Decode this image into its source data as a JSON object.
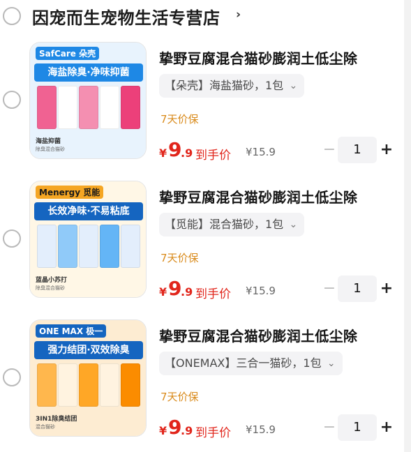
{
  "store": {
    "name": "因宠而生宠物生活专营店",
    "chevron": "›"
  },
  "items": [
    {
      "title": "挚野豆腐混合猫砂膨润土低尘除",
      "sku": "【朵壳】海盐猫砂，1包",
      "guarantee": "7天价保",
      "price_symbol": "¥",
      "price_int": "9",
      "price_dec": ".9",
      "price_label": "到手价",
      "original_price": "¥15.9",
      "quantity": "1",
      "thumb": {
        "logo": "SafCare 朵壳",
        "slogan": "海盐除臭·净味抑菌",
        "caption": "海盐抑菌",
        "caption_sub": "除臭混合猫砂",
        "accent": "#1e88e5",
        "slogan_bg": "#1e88e5",
        "bag_colors": [
          "#f06292",
          "#ffffff",
          "#f48fb1",
          "#ffffff",
          "#ec407a"
        ],
        "bg": "#e8f3fd"
      }
    },
    {
      "title": "挚野豆腐混合猫砂膨润土低尘除",
      "sku": "【觅能】混合猫砂，1包",
      "guarantee": "7天价保",
      "price_symbol": "¥",
      "price_int": "9",
      "price_dec": ".9",
      "price_label": "到手价",
      "original_price": "¥15.9",
      "quantity": "1",
      "thumb": {
        "logo": "Menergy 觅能",
        "slogan": "长效净味·不易粘底",
        "caption": "蓝晶小苏打",
        "caption_sub": "除臭混合猫砂",
        "accent": "#f5a623",
        "slogan_bg": "#1565c0",
        "bag_colors": [
          "#e3eefc",
          "#90caf9",
          "#e3eefc",
          "#64b5f6",
          "#e3eefc"
        ],
        "bg": "#fff7e6"
      }
    },
    {
      "title": "挚野豆腐混合猫砂膨润土低尘除",
      "sku": "【ONEMAX】三合一猫砂，1包",
      "guarantee": "7天价保",
      "price_symbol": "¥",
      "price_int": "9",
      "price_dec": ".9",
      "price_label": "到手价",
      "original_price": "¥15.9",
      "quantity": "1",
      "thumb": {
        "logo": "ONE MAX 极一",
        "slogan": "强力结团·双效除臭",
        "caption": "3IN1除臭结团",
        "caption_sub": "混合猫砂",
        "accent": "#1565c0",
        "slogan_bg": "#1565c0",
        "bag_colors": [
          "#ffb74d",
          "#fff3e0",
          "#ffa726",
          "#fff3e0",
          "#fb8c00"
        ],
        "bg": "#fdecd2"
      }
    }
  ],
  "controls": {
    "minus": "−",
    "plus": "+",
    "sku_arrow": "⌄"
  },
  "colors": {
    "price_red": "#e1251b",
    "guarantee_orange": "#d98a1a"
  }
}
